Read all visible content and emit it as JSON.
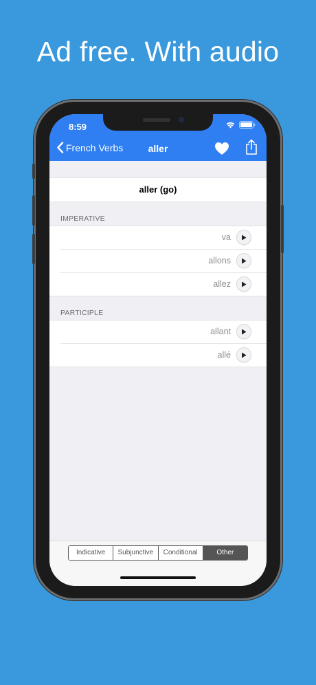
{
  "headline": "Ad free. With audio",
  "status": {
    "time": "8:59"
  },
  "nav": {
    "back_label": "French Verbs",
    "title": "aller"
  },
  "verb_title": "aller (go)",
  "sections": {
    "imperative": {
      "label": "IMPERATIVE",
      "forms": [
        "va",
        "allons",
        "allez"
      ]
    },
    "participle": {
      "label": "PARTICIPLE",
      "forms": [
        "allant",
        "allé"
      ]
    }
  },
  "tabs": [
    "Indicative",
    "Subjunctive",
    "Conditional",
    "Other"
  ],
  "active_tab": "Other",
  "colors": {
    "background": "#3a98dc",
    "nav_bar": "#2f7ff2",
    "segment_active": "#555555"
  }
}
